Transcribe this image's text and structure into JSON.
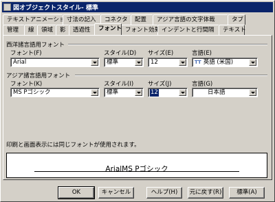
{
  "window": {
    "title": "図オブジェクトスタイル- 標準"
  },
  "tabs_back": [
    "テキストアニメーション",
    "寸法の記入",
    "コネクタ",
    "配置",
    "アジア言語の文字体裁",
    "タブ"
  ],
  "tabs_front": [
    "管理",
    "線",
    "領域",
    "影",
    "透過性",
    "フォント",
    "フォント効果",
    "インデントと行間隔",
    "テキスト"
  ],
  "active_tab": "フォント",
  "western": {
    "group_title": "西洋諸言語用フォント",
    "font_label": "フォント(F)",
    "font_value": "Arial",
    "style_label": "スタイル(D)",
    "style_value": "標準",
    "size_label": "サイズ(E)",
    "size_value": "12",
    "lang_label": "言語(E)",
    "lang_value": "英語 (米国)",
    "lang_icon": "TT"
  },
  "asian": {
    "group_title": "アジア諸言語用フォント",
    "font_label": "フォント(K)",
    "font_value": "MS Pゴシック",
    "style_label": "スタイル(I)",
    "style_value": "標準",
    "size_label": "サイズ(J)",
    "size_value": "12",
    "lang_label": "言語(G)",
    "lang_value": "日本語"
  },
  "note": "印刷と画面表示には同じフォントが使用されます。",
  "preview": {
    "text": "ArialMS Pゴシック"
  },
  "buttons": {
    "ok": "OK",
    "cancel": "キャンセル",
    "help": "ヘルプ(H)",
    "reset": "元に戻す(R)",
    "standard": "標準(A)"
  }
}
